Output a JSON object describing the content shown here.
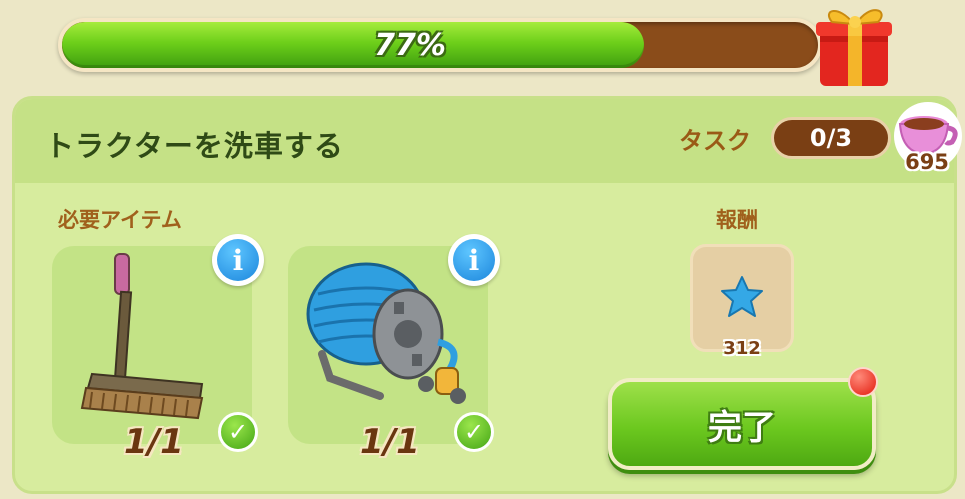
{
  "progress": {
    "value_percent": 77,
    "label": "77%",
    "fill_color": "#6dcf1a",
    "track_color": "#8a4c1a",
    "reward_icon": "gift-box-icon"
  },
  "quest": {
    "title": "トラクターを洗車する",
    "task_label": "タスク",
    "task_progress": "0/3"
  },
  "currency": {
    "icon": "teacup-icon",
    "count": "695"
  },
  "required": {
    "label": "必要アイテム",
    "items": [
      {
        "name": "broom",
        "icon": "broom-icon",
        "count": "1/1",
        "complete": true
      },
      {
        "name": "hose-reel",
        "icon": "hose-reel-icon",
        "count": "1/1",
        "complete": true
      }
    ]
  },
  "reward": {
    "label": "報酬",
    "icon": "blue-star-icon",
    "value": "312"
  },
  "actions": {
    "complete_label": "完了",
    "has_notification": true
  }
}
